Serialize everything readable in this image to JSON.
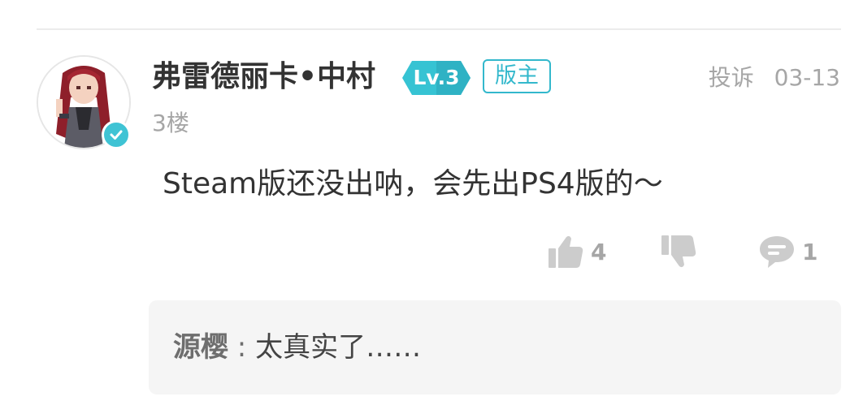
{
  "post": {
    "username": "弗雷德丽卡•中村",
    "level_badge": "Lv.3",
    "role_badge": "版主",
    "floor": "3楼",
    "report_label": "投诉",
    "date": "03-13",
    "content": "Steam版还没出呐，会先出PS4版的～",
    "likes": "4",
    "comments": "1",
    "icons": {
      "like": "thumbs-up-icon",
      "dislike": "thumbs-down-icon",
      "comment": "comment-bubble-icon",
      "verified": "verified-check-icon"
    }
  },
  "reply": {
    "author": "源樱",
    "separator": " : ",
    "text": "太真实了……"
  },
  "colors": {
    "accent": "#33b8cc",
    "text_primary": "#333333",
    "text_secondary": "#a6a6a6",
    "reply_bg": "#f5f5f5"
  }
}
